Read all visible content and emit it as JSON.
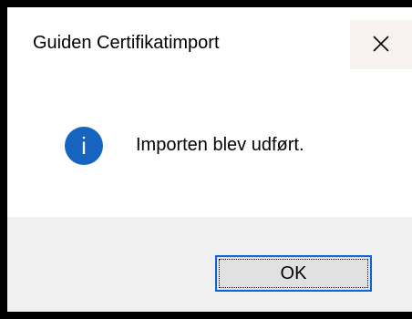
{
  "window": {
    "title": "Guiden Certifikatimport",
    "close_icon": "close-x-icon"
  },
  "content": {
    "icon": "info-icon",
    "icon_color": "#1565c0",
    "icon_glyph": "i",
    "message": "Importen blev udført."
  },
  "footer": {
    "ok_label": "OK"
  },
  "colors": {
    "accent": "#0a64d8",
    "footer_bg": "#f0f0f0",
    "close_hover_bg": "#f7f1f0"
  }
}
